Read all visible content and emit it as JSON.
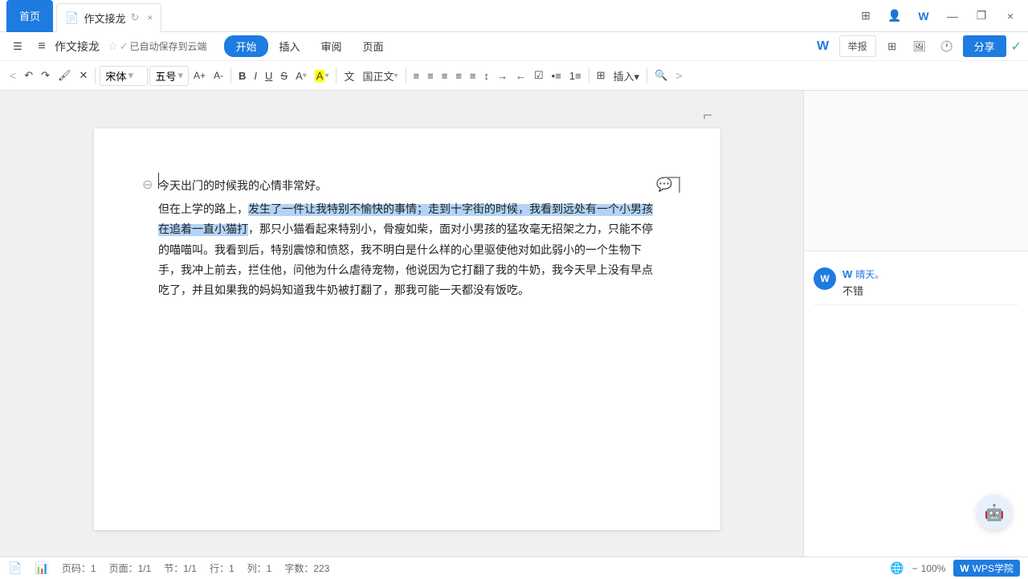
{
  "titlebar": {
    "home_tab": "首页",
    "doc_tab_name": "作文接龙",
    "close_label": "×",
    "minimize": "—",
    "restore": "❐"
  },
  "menubar": {
    "doc_title": "作文接龙",
    "save_status": "已自动保存到云端",
    "tabs": [
      "开始",
      "插入",
      "审阅",
      "页面"
    ],
    "active_tab": "开始",
    "report_label": "举报",
    "share_label": "分享"
  },
  "toolbar": {
    "undo": "↶",
    "redo": "↷",
    "paint": "🖌",
    "clear": "✕",
    "font_name": "宋体",
    "font_size": "五号",
    "size_increase": "A+",
    "size_decrease": "A-",
    "bold": "B",
    "italic": "I",
    "underline": "U",
    "strikethrough": "S",
    "font_color": "A",
    "highlight": "A",
    "char_spacing": "文",
    "align_left_distribute": "≡",
    "align_center": "≡",
    "align_right": "≡",
    "align_justify": "≡",
    "align_distribute": "≡",
    "indent_increase": "→",
    "indent_decrease": "←",
    "checklist": "☑",
    "bullet_list": "•≡",
    "numbered_list": "1≡",
    "insert_table": "⊞",
    "insert": "插入",
    "find": "🔍"
  },
  "document": {
    "content_line1": "今天出门的时候我的心情非常好。",
    "content_line2": "但在上学的路上，发生了一件让我特别不愉快的事情；走到十字街的时候，我看到远处有一个小男孩在追着一直小猫打，那只小猫看起来特别小，骨瘦如柴，面对小男孩的猛攻毫无招架之力，只能不停的喵喵叫。我看到后，特别震惊和愤怒，我不明白是什么样的心里驱使他对如此弱小的一个生物下手，我冲上前去，拦住他，问他为什么虐待宠物，他说因为它打翻了我的牛奶，我今天早上没有早点吃了，并且如果我的妈妈知道我牛奶被打翻了，那我可能一天都没有饭吃。",
    "highlighted_text": "发生了一件让我特别不愉快的事情；走到十字街的时候，我看到远处有一个小男孩在追着一直小猫打"
  },
  "comment": {
    "author": "晴天。",
    "text": "不错",
    "wps_icon": "W"
  },
  "statusbar": {
    "page_label": "页码：1",
    "pages": "页面：1/1",
    "section": "节：1/1",
    "row": "行：1",
    "col": "列：1",
    "word_count": "字数：223",
    "zoom": "100%",
    "wps_label": "WPS学院"
  },
  "icons": {
    "menu": "☰",
    "doc_icon": "📄",
    "star": "☆",
    "cloud_save": "☁",
    "wps_w": "W",
    "check_green": "✓",
    "comment": "💬",
    "paragraph": "¶"
  }
}
